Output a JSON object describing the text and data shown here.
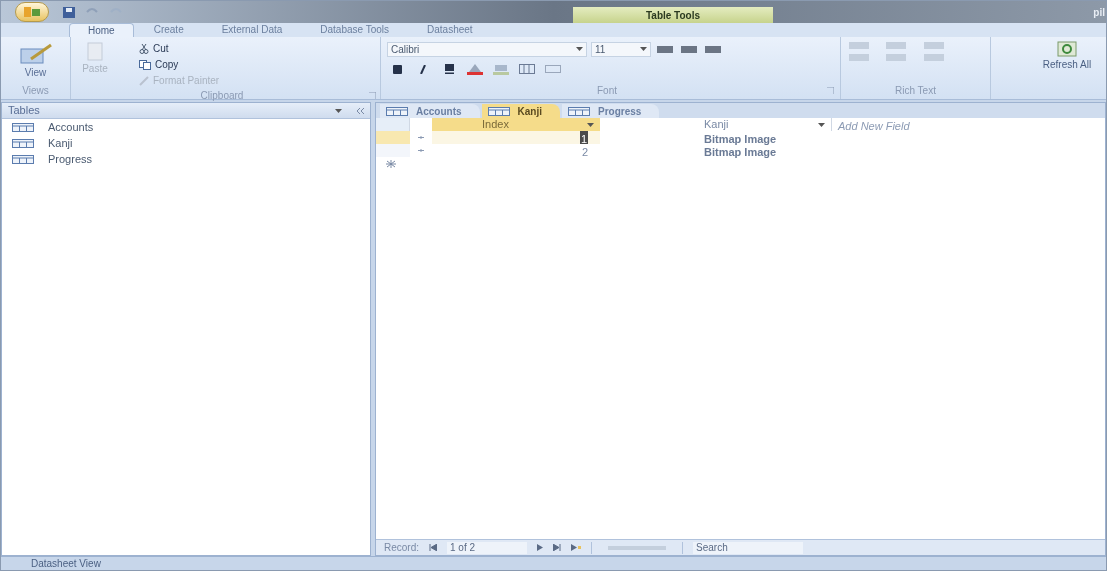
{
  "title_bar": {
    "contextual_label": "Table Tools",
    "title": "pil"
  },
  "ribbon_tabs": [
    {
      "label": "Home",
      "selected": true
    },
    {
      "label": "Create",
      "selected": false
    },
    {
      "label": "External Data",
      "selected": false
    },
    {
      "label": "Database Tools",
      "selected": false
    },
    {
      "label": "Datasheet",
      "selected": false
    }
  ],
  "ribbon": {
    "views": {
      "label": "Views",
      "view_button": "View"
    },
    "clipboard": {
      "label": "Clipboard",
      "paste": {
        "label": "Paste",
        "disabled": true
      },
      "cut": {
        "label": "Cut",
        "disabled": false
      },
      "copy": {
        "label": "Copy",
        "disabled": false
      },
      "format_painter": {
        "label": "Format Painter",
        "disabled": true
      }
    },
    "font": {
      "label": "Font",
      "font_name": "Calibri",
      "font_size": "11"
    },
    "rich_text": {
      "label": "Rich Text"
    },
    "refresh": {
      "label": "Refresh All"
    }
  },
  "nav_pane": {
    "title": "Tables",
    "items": [
      {
        "label": "Accounts"
      },
      {
        "label": "Kanji"
      },
      {
        "label": "Progress"
      }
    ]
  },
  "doc_tabs": [
    {
      "label": "Accounts",
      "selected": false
    },
    {
      "label": "Kanji",
      "selected": true
    },
    {
      "label": "Progress",
      "selected": false
    }
  ],
  "datasheet": {
    "columns": [
      {
        "label": "Index"
      },
      {
        "label": "Kanji"
      }
    ],
    "add_field": "Add New Field",
    "rows": [
      {
        "index": "1",
        "kanji": "Bitmap Image",
        "current": true
      },
      {
        "index": "2",
        "kanji": "Bitmap Image",
        "current": false
      }
    ]
  },
  "record_nav": {
    "label": "Record:",
    "position": "1 of 2",
    "search_placeholder": "Search"
  },
  "status_bar": "Datasheet View"
}
